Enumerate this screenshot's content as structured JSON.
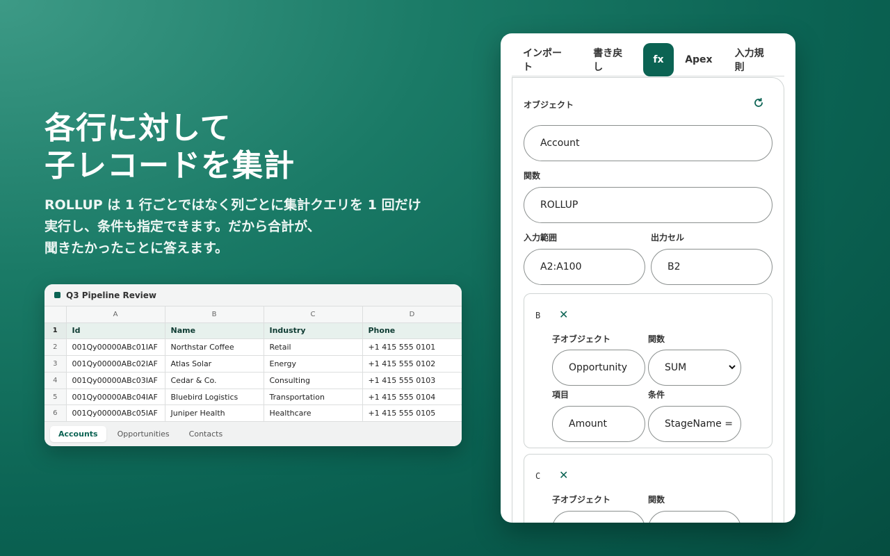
{
  "hero": {
    "title_line1": "各行に対して",
    "title_line2": "子レコードを集計",
    "body_line1": "ROLLUP は 1 行ごとではなく列ごとに集計クエリを 1 回だけ",
    "body_line2": "実行し、条件も指定できます。だから合計が、",
    "body_line3": "聞きたかったことに答えます。"
  },
  "sheet": {
    "title": "Q3 Pipeline Review",
    "column_letters": [
      "A",
      "B",
      "C",
      "D"
    ],
    "header_row": {
      "num": "1",
      "cells": [
        "Id",
        "Name",
        "Industry",
        "Phone"
      ]
    },
    "rows": [
      {
        "num": "2",
        "cells": [
          "001Qy00000ABc01IAF",
          "Northstar Coffee",
          "Retail",
          "+1 415 555 0101"
        ]
      },
      {
        "num": "3",
        "cells": [
          "001Qy00000ABc02IAF",
          "Atlas Solar",
          "Energy",
          "+1 415 555 0102"
        ]
      },
      {
        "num": "4",
        "cells": [
          "001Qy00000ABc03IAF",
          "Cedar & Co.",
          "Consulting",
          "+1 415 555 0103"
        ]
      },
      {
        "num": "5",
        "cells": [
          "001Qy00000ABc04IAF",
          "Bluebird Logistics",
          "Transportation",
          "+1 415 555 0104"
        ]
      },
      {
        "num": "6",
        "cells": [
          "001Qy00000ABc05IAF",
          "Juniper Health",
          "Healthcare",
          "+1 415 555 0105"
        ]
      }
    ],
    "tabs": [
      "Accounts",
      "Opportunities",
      "Contacts"
    ],
    "active_tab": "Accounts"
  },
  "panel": {
    "tabs": [
      "インポート",
      "書き戻し",
      "fx",
      "Apex",
      "入力規則"
    ],
    "active_tab": "fx",
    "object_label": "オブジェクト",
    "object_value": "Account",
    "function_label": "関数",
    "function_value": "ROLLUP",
    "input_range_label": "入力範囲",
    "input_range_value": "A2:A100",
    "output_cell_label": "出力セル",
    "output_cell_value": "B2",
    "groups": [
      {
        "key": "B",
        "child_object_label": "子オブジェクト",
        "child_object_value": "Opportunity",
        "function_label": "関数",
        "function_value": "SUM",
        "field_label": "項目",
        "field_value": "Amount",
        "condition_label": "条件",
        "condition_value": "StageName ="
      },
      {
        "key": "C",
        "child_object_label": "子オブジェクト",
        "function_label": "関数"
      }
    ]
  },
  "colors": {
    "accent": "#0b6353",
    "background_light": "#3d9a86",
    "background_dark": "#054d40"
  }
}
